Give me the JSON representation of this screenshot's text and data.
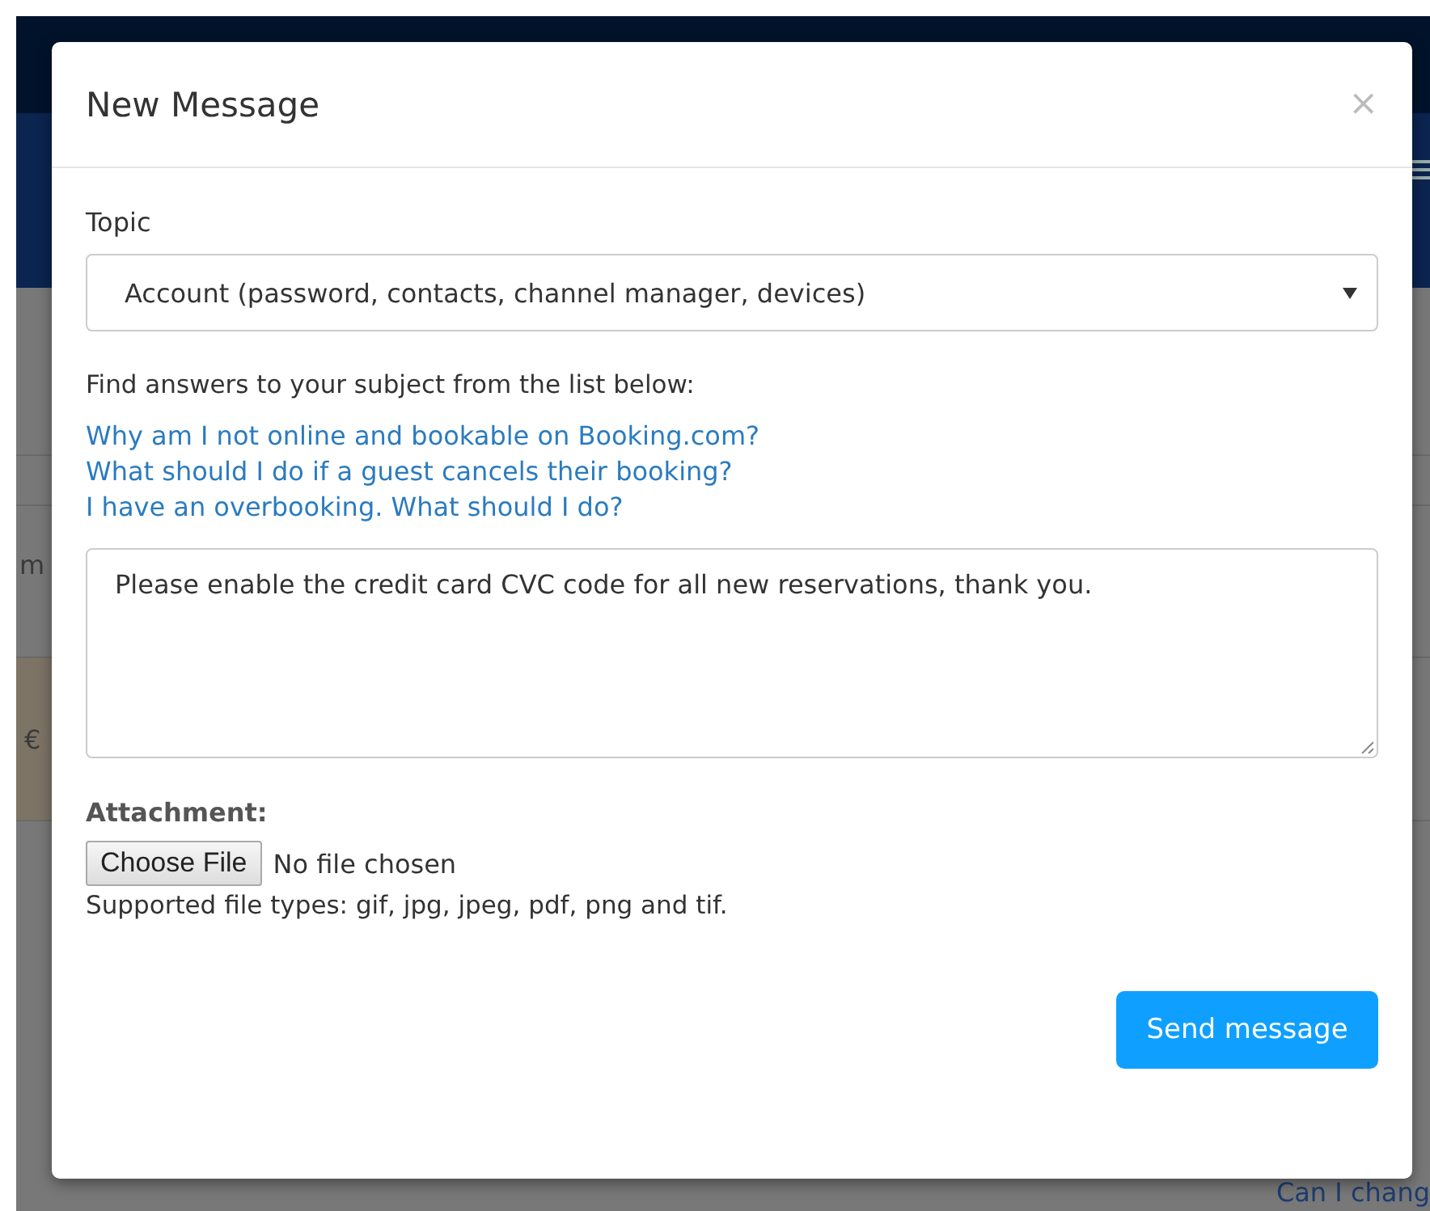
{
  "background": {
    "left_fragments": [
      "m",
      "€"
    ],
    "bottom_fragment": "Can I chang"
  },
  "modal": {
    "title": "New Message",
    "close": "×",
    "topic": {
      "label": "Topic",
      "value": "Account (password, contacts, channel manager, devices)"
    },
    "hint": "Find answers to your subject from the list below:",
    "links": [
      "Why am I not online and bookable on Booking.com?",
      "What should I do if a guest cancels their booking?",
      "I have an overbooking. What should I do?"
    ],
    "message": {
      "value": "Please enable the credit card CVC code for all new reservations, thank you."
    },
    "attachment": {
      "label": "Attachment:",
      "button": "Choose File",
      "status": "No file chosen",
      "note": "Supported file types: gif, jpg, jpeg, pdf, png and tif."
    },
    "send": "Send message"
  }
}
